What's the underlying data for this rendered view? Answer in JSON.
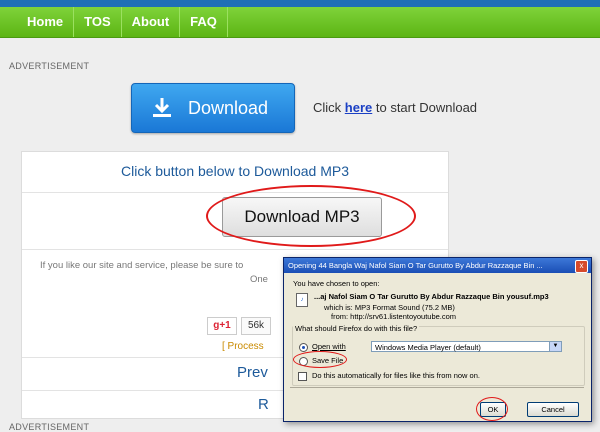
{
  "nav": {
    "items": [
      "Home",
      "TOS",
      "About",
      "FAQ"
    ]
  },
  "ads": {
    "top_label": "ADVERTISEMENT",
    "bottom_label": "ADVERTISEMENT"
  },
  "download_banner": {
    "button_label": "Download",
    "prompt_before": "Click ",
    "prompt_link": "here",
    "prompt_after": " to start Download"
  },
  "panel": {
    "header": "Click button below to Download MP3",
    "mp3_button": "Download MP3",
    "share_text": "If you like our site and service, please be sure to",
    "one_text": "One",
    "gplus_label": "g+1",
    "gplus_count": "56k",
    "process_text": "[ Process",
    "prev_text": "Prev",
    "re_text": "R"
  },
  "dialog": {
    "title": "Opening 44 Bangla Waj Nafol Siam O Tar Gurutto By Abdur Razzaque Bin ...",
    "chosen_label": "You have chosen to open:",
    "filename": "...aj Nafol Siam O Tar Gurutto By Abdur Razzaque Bin yousuf.mp3",
    "which_is": "which is:  MP3 Format Sound (75.2 MB)",
    "from": "from:  http://srv61.listentoyoutube.com",
    "question": "What should Firefox do with this file?",
    "open_with_label": "Open with",
    "open_with_app": "Windows Media Player (default)",
    "save_file_label": "Save File",
    "auto_label": "Do this automatically for files like this from now on.",
    "ok_label": "OK",
    "cancel_label": "Cancel",
    "close_glyph": "x"
  },
  "colors": {
    "nav_green": "#5cb514",
    "button_blue": "#1a78d6",
    "annotation_red": "#e01a1a",
    "dialog_title_blue": "#1a4eb5"
  }
}
